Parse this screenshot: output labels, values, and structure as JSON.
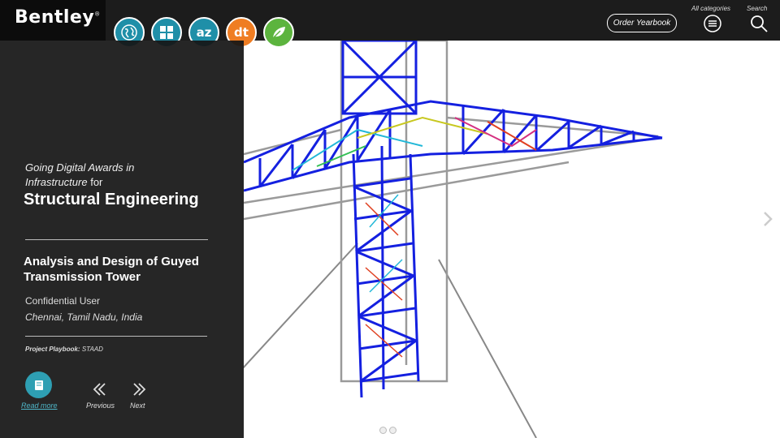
{
  "header": {
    "logo": "Bentley",
    "logo_mark": "®",
    "category_icons": [
      {
        "name": "globe-icon",
        "color": "#1f8fa8",
        "glyph": ""
      },
      {
        "name": "grid-icon",
        "color": "#1f8fa8",
        "glyph": ""
      },
      {
        "name": "az-icon",
        "color": "#1f8fa8",
        "glyph": "az"
      },
      {
        "name": "dt-icon",
        "color": "#ef7d22",
        "glyph": "dt"
      },
      {
        "name": "leaf-icon",
        "color": "#5cb43e",
        "glyph": ""
      }
    ],
    "order_yearbook": "Order Yearbook",
    "all_categories_label": "All categories",
    "search_label": "Search"
  },
  "panel": {
    "award_italic": "Going Digital Awards in",
    "award_italic2": "Infrastructure",
    "award_for": "for",
    "category": "Structural Engineering",
    "project_title": "Analysis and Design of Guyed Transmission Tower",
    "organization": "Confidential User",
    "location": "Chennai, Tamil Nadu, India",
    "playbook_label": "Project Playbook:",
    "playbook_value": "STAAD",
    "read_more": "Read more",
    "previous": "Previous",
    "next": "Next"
  },
  "colors": {
    "teal": "#2e9fb3",
    "orange": "#ef7d22",
    "green": "#5cb43e",
    "tower_blue": "#1420e0",
    "tower_grey": "#9a9a9a"
  }
}
